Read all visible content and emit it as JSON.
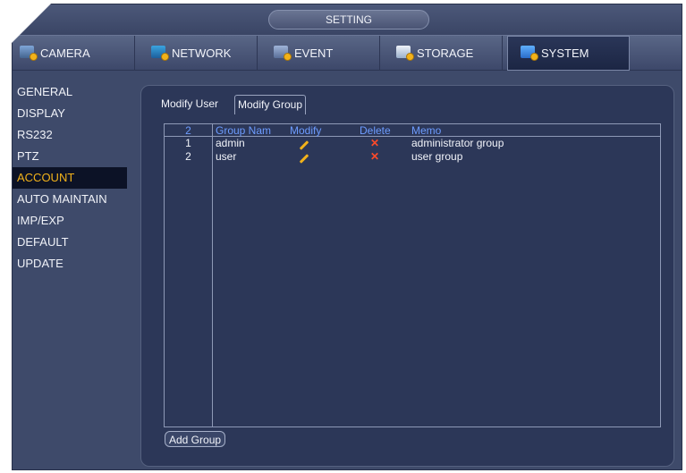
{
  "window": {
    "title": "SETTING"
  },
  "tabs": [
    {
      "label": "CAMERA",
      "icon": "camera-gear-icon",
      "active": false
    },
    {
      "label": "NETWORK",
      "icon": "network-gear-icon",
      "active": false
    },
    {
      "label": "EVENT",
      "icon": "event-gear-icon",
      "active": false
    },
    {
      "label": "STORAGE",
      "icon": "storage-gear-icon",
      "active": false
    },
    {
      "label": "SYSTEM",
      "icon": "system-gear-icon",
      "active": true
    }
  ],
  "sidebar": {
    "items": [
      {
        "label": "GENERAL",
        "active": false
      },
      {
        "label": "DISPLAY",
        "active": false
      },
      {
        "label": "RS232",
        "active": false
      },
      {
        "label": "PTZ",
        "active": false
      },
      {
        "label": "ACCOUNT",
        "active": true
      },
      {
        "label": "AUTO MAINTAIN",
        "active": false
      },
      {
        "label": "IMP/EXP",
        "active": false
      },
      {
        "label": "DEFAULT",
        "active": false
      },
      {
        "label": "UPDATE",
        "active": false
      }
    ]
  },
  "subtabs": [
    {
      "label": "Modify User",
      "active": false
    },
    {
      "label": "Modify Group",
      "active": true
    }
  ],
  "table": {
    "headers": {
      "count": "2",
      "name": "Group Nam",
      "modify": "Modify",
      "delete": "Delete",
      "memo": "Memo"
    },
    "rows": [
      {
        "no": "1",
        "name": "admin",
        "memo": "administrator group"
      },
      {
        "no": "2",
        "name": "user",
        "memo": "user group"
      }
    ]
  },
  "buttons": {
    "add_group": "Add Group"
  },
  "icons": {
    "modify": "pencil-icon",
    "delete": "delete-x-icon"
  },
  "colors": {
    "accent": "#f2b21a",
    "header_text": "#6d9cff",
    "delete": "#ff4a2a",
    "background": "#3e4a6a"
  }
}
